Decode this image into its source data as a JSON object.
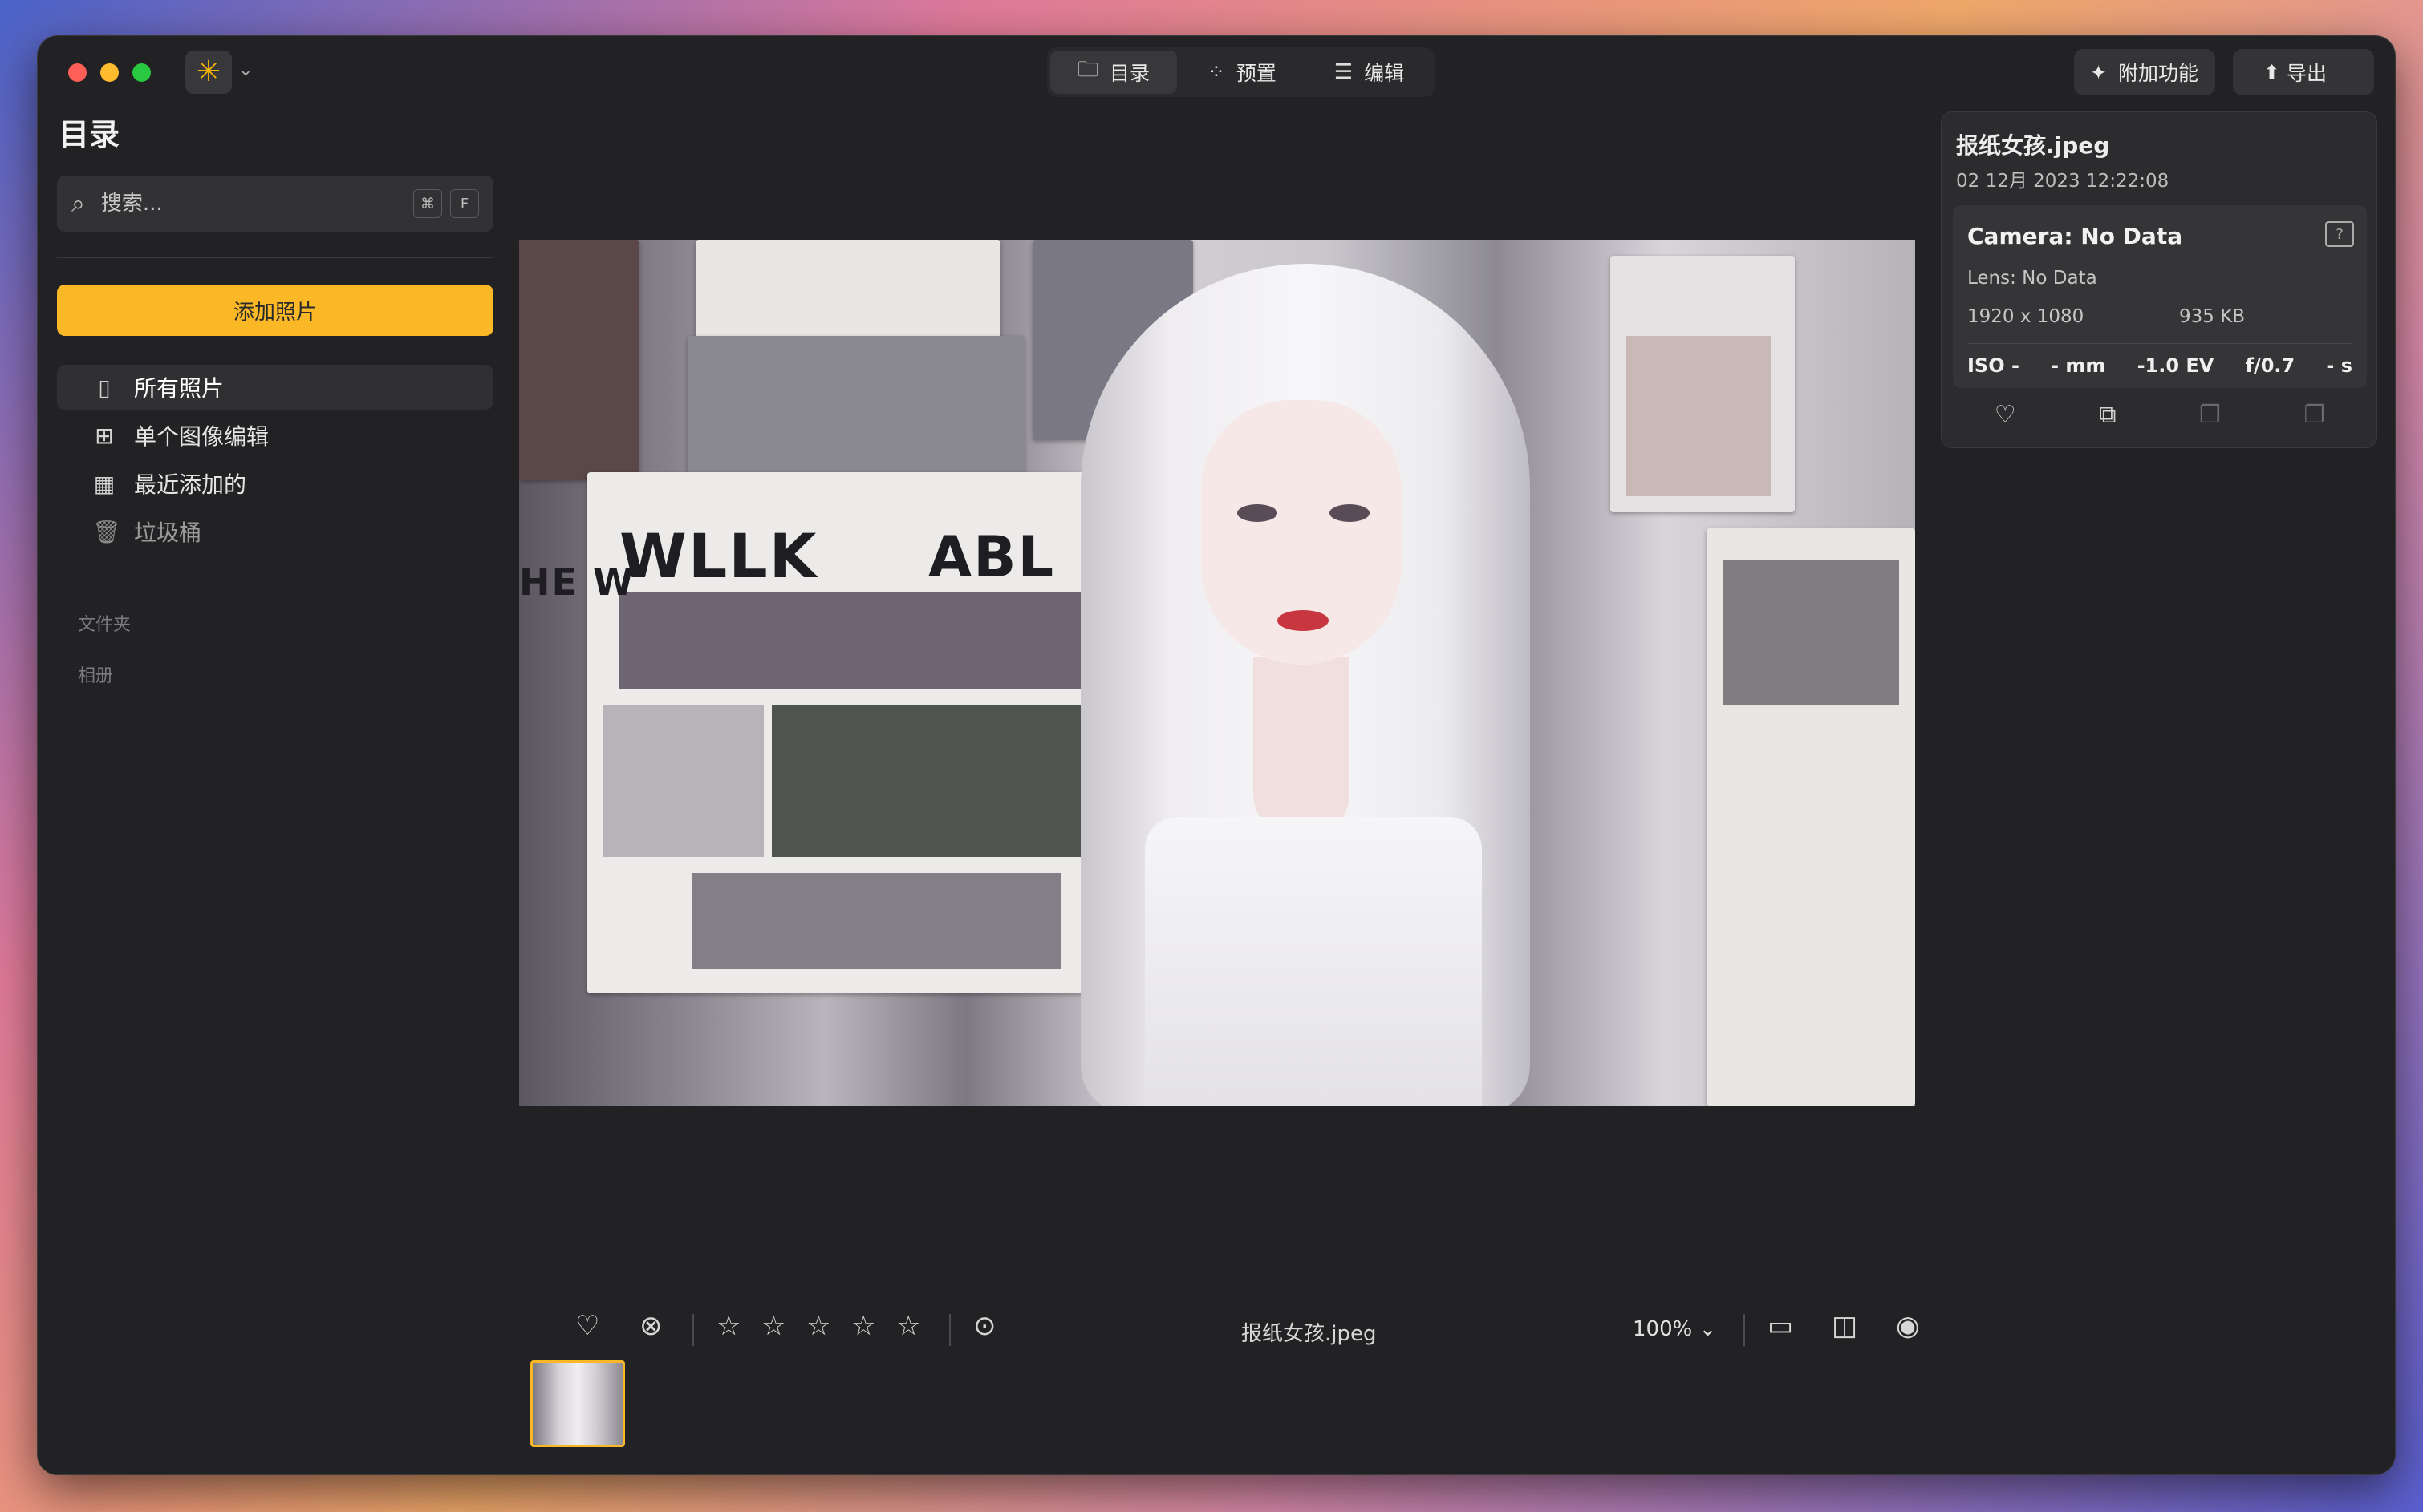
{
  "colors": {
    "accent": "#fbb826",
    "window_bg": "#222224",
    "panel_bg": "#2c2c2e"
  },
  "top_nav": {
    "tabs": [
      {
        "icon": "folder-icon",
        "label": "目录",
        "active": true
      },
      {
        "icon": "magic-wand-icon",
        "label": "预置",
        "active": false
      },
      {
        "icon": "sliders-icon",
        "label": "编辑",
        "active": false
      }
    ],
    "addons_label": "附加功能",
    "export_label": "导出"
  },
  "sidebar": {
    "title": "目录",
    "search": {
      "placeholder": "搜索...",
      "shortcut_mod": "⌘",
      "shortcut_key": "F"
    },
    "add_button": "添加照片",
    "items": [
      {
        "icon": "photos-icon",
        "label": "所有照片",
        "active": true
      },
      {
        "icon": "grid-icon",
        "label": "单个图像编辑",
        "active": false
      },
      {
        "icon": "calendar-icon",
        "label": "最近添加的",
        "active": false
      },
      {
        "icon": "trash-icon",
        "label": "垃圾桶",
        "active": false
      }
    ],
    "sections": [
      "文件夹",
      "相册"
    ]
  },
  "photo": {
    "headline_left": "WLLK",
    "headline_right": "ABL BFIAEE",
    "headline_partial": "HE W"
  },
  "info_panel": {
    "filename": "报纸女孩.jpeg",
    "date": "02 12月 2023 12:22:08",
    "camera": "Camera: No Data",
    "lens": "Lens: No Data",
    "resolution": "1920 x 1080",
    "file_size": "935 KB",
    "exif": {
      "iso": "ISO -",
      "focal": "- mm",
      "ev": "-1.0 EV",
      "aperture": "f/0.7",
      "shutter": "- s"
    }
  },
  "bottom_bar": {
    "filename": "报纸女孩.jpeg",
    "zoom": "100%",
    "rating": 0,
    "rating_max": 5
  }
}
